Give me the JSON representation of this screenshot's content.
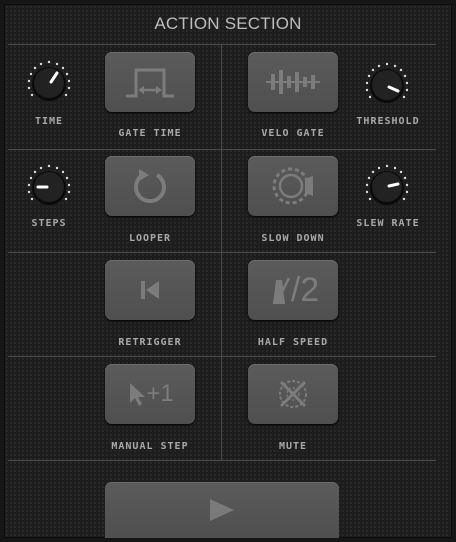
{
  "header": {
    "title": "ACTION SECTION"
  },
  "knobs": {
    "time": {
      "label": "TIME"
    },
    "threshold": {
      "label": "THRESHOLD"
    },
    "steps": {
      "label": "STEPS"
    },
    "slew_rate": {
      "label": "SLEW RATE"
    }
  },
  "buttons": {
    "gate_time": {
      "label": "GATE TIME",
      "icon": "gate-time-icon"
    },
    "velo_gate": {
      "label": "VELO GATE",
      "icon": "velocity-gate-icon"
    },
    "looper": {
      "label": "LOOPER",
      "icon": "loop-icon"
    },
    "slow_down": {
      "label": "SLOW DOWN",
      "icon": "slow-down-icon"
    },
    "retrigger": {
      "label": "RETRIGGER",
      "icon": "skip-back-icon"
    },
    "half_speed": {
      "label": "HALF SPEED",
      "icon": "metronome-half-icon",
      "glyph": "/2"
    },
    "manual_step": {
      "label": "MANUAL STEP",
      "icon": "cursor-plus-one-icon",
      "glyph": "+1"
    },
    "mute": {
      "label": "MUTE",
      "icon": "mute-icon"
    },
    "play": {
      "icon": "play-icon"
    }
  },
  "colors": {
    "background": "#1d1d1d",
    "button": "#555555",
    "icon": "#7c7c7c",
    "label": "#a9a9a9",
    "knob_indicator": "#ffffff"
  }
}
